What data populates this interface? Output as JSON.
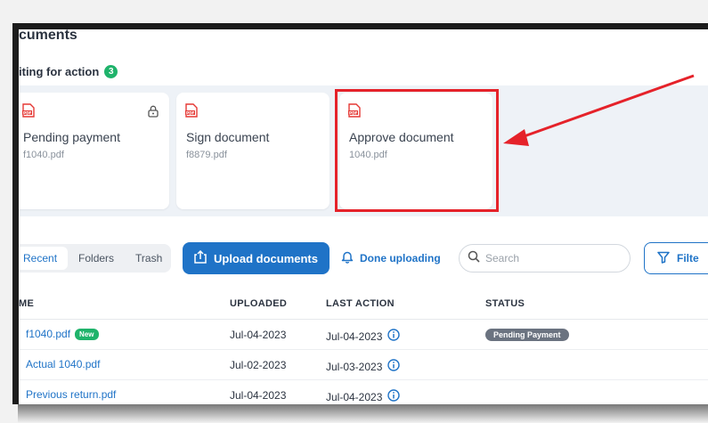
{
  "page": {
    "title": "cuments",
    "waiting_label": "iting for action",
    "waiting_count": "3"
  },
  "cards": [
    {
      "title": "Pending payment",
      "file": "f1040.pdf",
      "icon": "pdf-icon",
      "locked": true
    },
    {
      "title": "Sign document",
      "file": "f8879.pdf",
      "icon": "pdf-icon",
      "locked": false
    },
    {
      "title": "Approve document",
      "file": "1040.pdf",
      "icon": "pdf-icon",
      "locked": false
    }
  ],
  "toolbar": {
    "tabs": [
      "Recent",
      "Folders",
      "Trash"
    ],
    "active_tab": "Recent",
    "upload_label": "Upload documents",
    "done_label": "Done uploading",
    "search_placeholder": "Search",
    "filter_label": "Filte"
  },
  "table": {
    "headers": {
      "name": "ME",
      "uploaded": "UPLOADED",
      "last_action": "LAST ACTION",
      "status": "STATUS"
    },
    "rows": [
      {
        "name": "f1040.pdf",
        "badge": "New",
        "uploaded": "Jul-04-2023",
        "last_action": "Jul-04-2023",
        "status": "Pending Payment"
      },
      {
        "name": "Actual 1040.pdf",
        "badge": "",
        "uploaded": "Jul-02-2023",
        "last_action": "Jul-03-2023",
        "status": ""
      },
      {
        "name": "Previous return.pdf",
        "badge": "",
        "uploaded": "Jul-04-2023",
        "last_action": "Jul-04-2023",
        "status": ""
      }
    ]
  },
  "colors": {
    "accent": "#1f73c7",
    "highlight": "#e5222a",
    "badge_green": "#1fb36b",
    "pdf_red": "#e53935"
  }
}
